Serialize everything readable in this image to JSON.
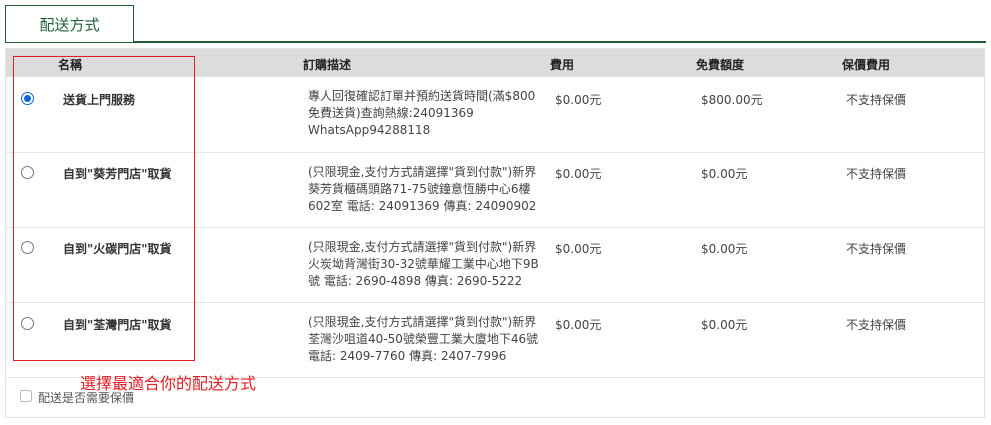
{
  "tab": {
    "label": "配送方式"
  },
  "table": {
    "headers": {
      "name": "名稱",
      "desc": "訂購描述",
      "fee": "費用",
      "free": "免費額度",
      "insurance": "保價費用"
    },
    "rows": [
      {
        "selected": true,
        "name": "送貨上門服務",
        "desc": "專人回復確認訂單并預約送貨時間(滿$800\n免費送貨)查詢熱線:24091369\nWhatsApp94288118",
        "fee": "$0.00元",
        "free": "$800.00元",
        "insurance": "不支持保價"
      },
      {
        "selected": false,
        "name": "自到\"葵芳門店\"取貨",
        "desc": "(只限現金,支付方式請選擇\"貨到付款\")新界\n葵芳貨櫃碼頭路71-75號鐘意恆勝中心6樓\n602室 電話: 24091369 傳真: 24090902",
        "fee": "$0.00元",
        "free": "$0.00元",
        "insurance": "不支持保價"
      },
      {
        "selected": false,
        "name": "自到\"火碳門店\"取貨",
        "desc": "(只限現金,支付方式請選擇\"貨到付款\")新界\n火炭坳背灣街30-32號華耀工業中心地下9B\n號 電話: 2690-4898 傳真: 2690-5222",
        "fee": "$0.00元",
        "free": "$0.00元",
        "insurance": "不支持保價"
      },
      {
        "selected": false,
        "name": "自到\"荃灣門店\"取貨",
        "desc": "(只限現金,支付方式請選擇\"貨到付款\")新界\n荃灣沙咀道40-50號榮豐工業大廈地下46號\n電話: 2409-7760 傳真: 2407-7996",
        "fee": "$0.00元",
        "free": "$0.00元",
        "insurance": "不支持保價"
      }
    ]
  },
  "annotation": {
    "text": "選擇最適合你的配送方式",
    "color": "#e51c23"
  },
  "insurance_option": {
    "label": "配送是否需要保價",
    "checked": false
  },
  "colors": {
    "accent": "#1f5f3a",
    "header_bg": "#dcdcdc",
    "radio_selected": "#0a66d6"
  }
}
